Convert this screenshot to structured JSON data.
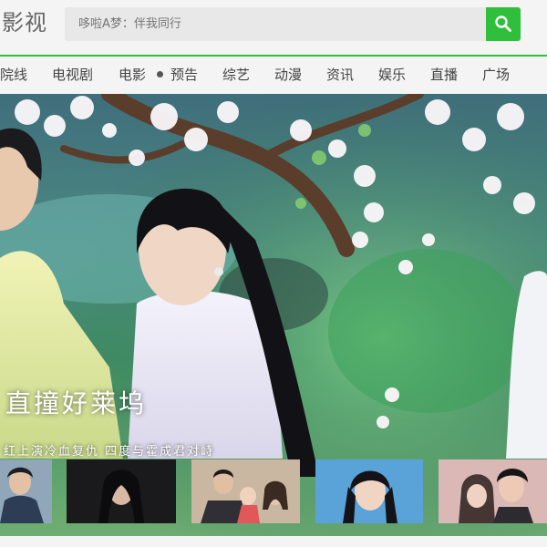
{
  "header": {
    "logo_text": "影视",
    "search_placeholder": "哆啦A梦：伴我同行",
    "search_icon": "search-icon",
    "accent_color": "#2fbf3a"
  },
  "nav": {
    "items": [
      "院线",
      "电视剧",
      "电影",
      "预告",
      "综艺",
      "动漫",
      "资讯",
      "娱乐",
      "直播",
      "广场"
    ]
  },
  "banner": {
    "title": "直撞好莱坞",
    "subtitle": "红上演冷血复仇 四度与霍成君对峙"
  },
  "thumbnails": [
    "thumb-1",
    "thumb-2",
    "thumb-3",
    "thumb-4",
    "thumb-5"
  ]
}
